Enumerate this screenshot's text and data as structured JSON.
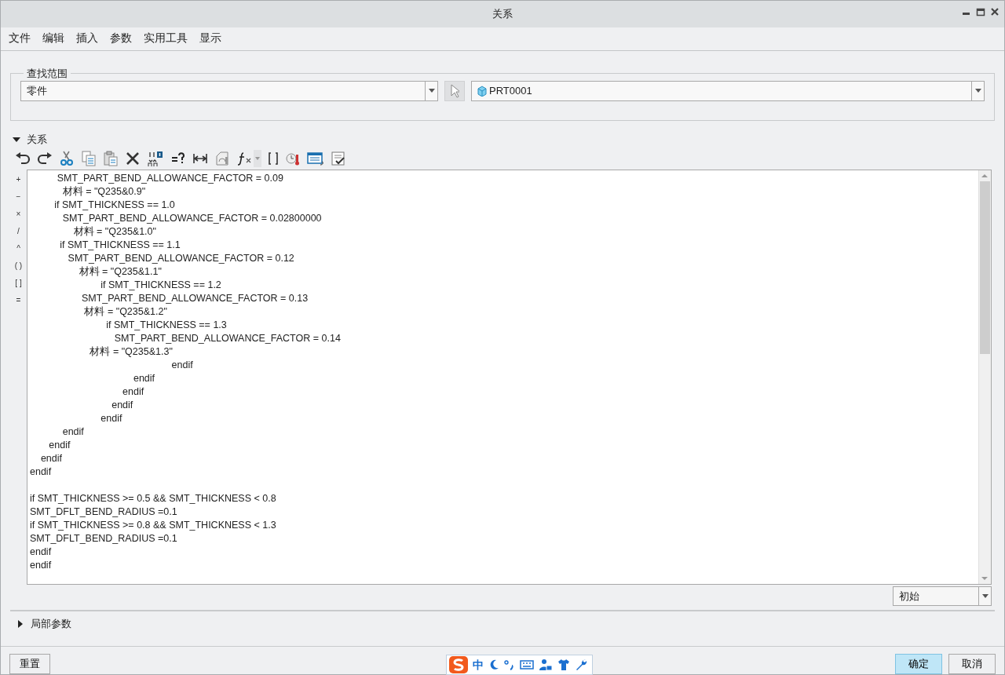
{
  "window": {
    "title": "关系"
  },
  "menu": [
    "文件",
    "编辑",
    "插入",
    "参数",
    "实用工具",
    "显示"
  ],
  "search_scope": {
    "legend": "查找范围",
    "type_value": "零件",
    "model_value": "PRT0001"
  },
  "relations": {
    "header": "关系",
    "expanded": true,
    "operators": [
      "+",
      "−",
      "×",
      "/",
      "^",
      "( )",
      "[ ]",
      "="
    ],
    "code_blocks": [
      [
        "          SMT_PART_BEND_ALLOWANCE_FACTOR = 0.09",
        "            材料 = \"Q235&0.9\"",
        "         if SMT_THICKNESS == 1.0",
        "            SMT_PART_BEND_ALLOWANCE_FACTOR = 0.02800000",
        "                材料 = \"Q235&1.0\"",
        "           if SMT_THICKNESS == 1.1",
        "              SMT_PART_BEND_ALLOWANCE_FACTOR = 0.12",
        "                  材料 = \"Q235&1.1\"",
        "                          if SMT_THICKNESS == 1.2",
        "                   SMT_PART_BEND_ALLOWANCE_FACTOR = 0.13",
        "                    材料 = \"Q235&1.2\"",
        "                            if SMT_THICKNESS == 1.3",
        "                               SMT_PART_BEND_ALLOWANCE_FACTOR = 0.14",
        "                      材料 = \"Q235&1.3\"",
        "                                                    endif",
        "                                      endif",
        "                                  endif",
        "                              endif",
        "                          endif",
        "            endif",
        "       endif",
        "    endif",
        "endif"
      ],
      [
        "if SMT_THICKNESS >= 0.5 && SMT_THICKNESS < 0.8",
        "SMT_DFLT_BEND_RADIUS =0.1",
        "if SMT_THICKNESS >= 0.8 && SMT_THICKNESS < 1.3",
        "SMT_DFLT_BEND_RADIUS =0.1",
        "endif",
        "endif"
      ]
    ],
    "units_value": "初始"
  },
  "local_params": {
    "header": "局部参数",
    "expanded": false
  },
  "buttons": {
    "reset": "重置",
    "ok": "确定",
    "cancel": "取消"
  },
  "ime_bar": {
    "mode": "中"
  }
}
